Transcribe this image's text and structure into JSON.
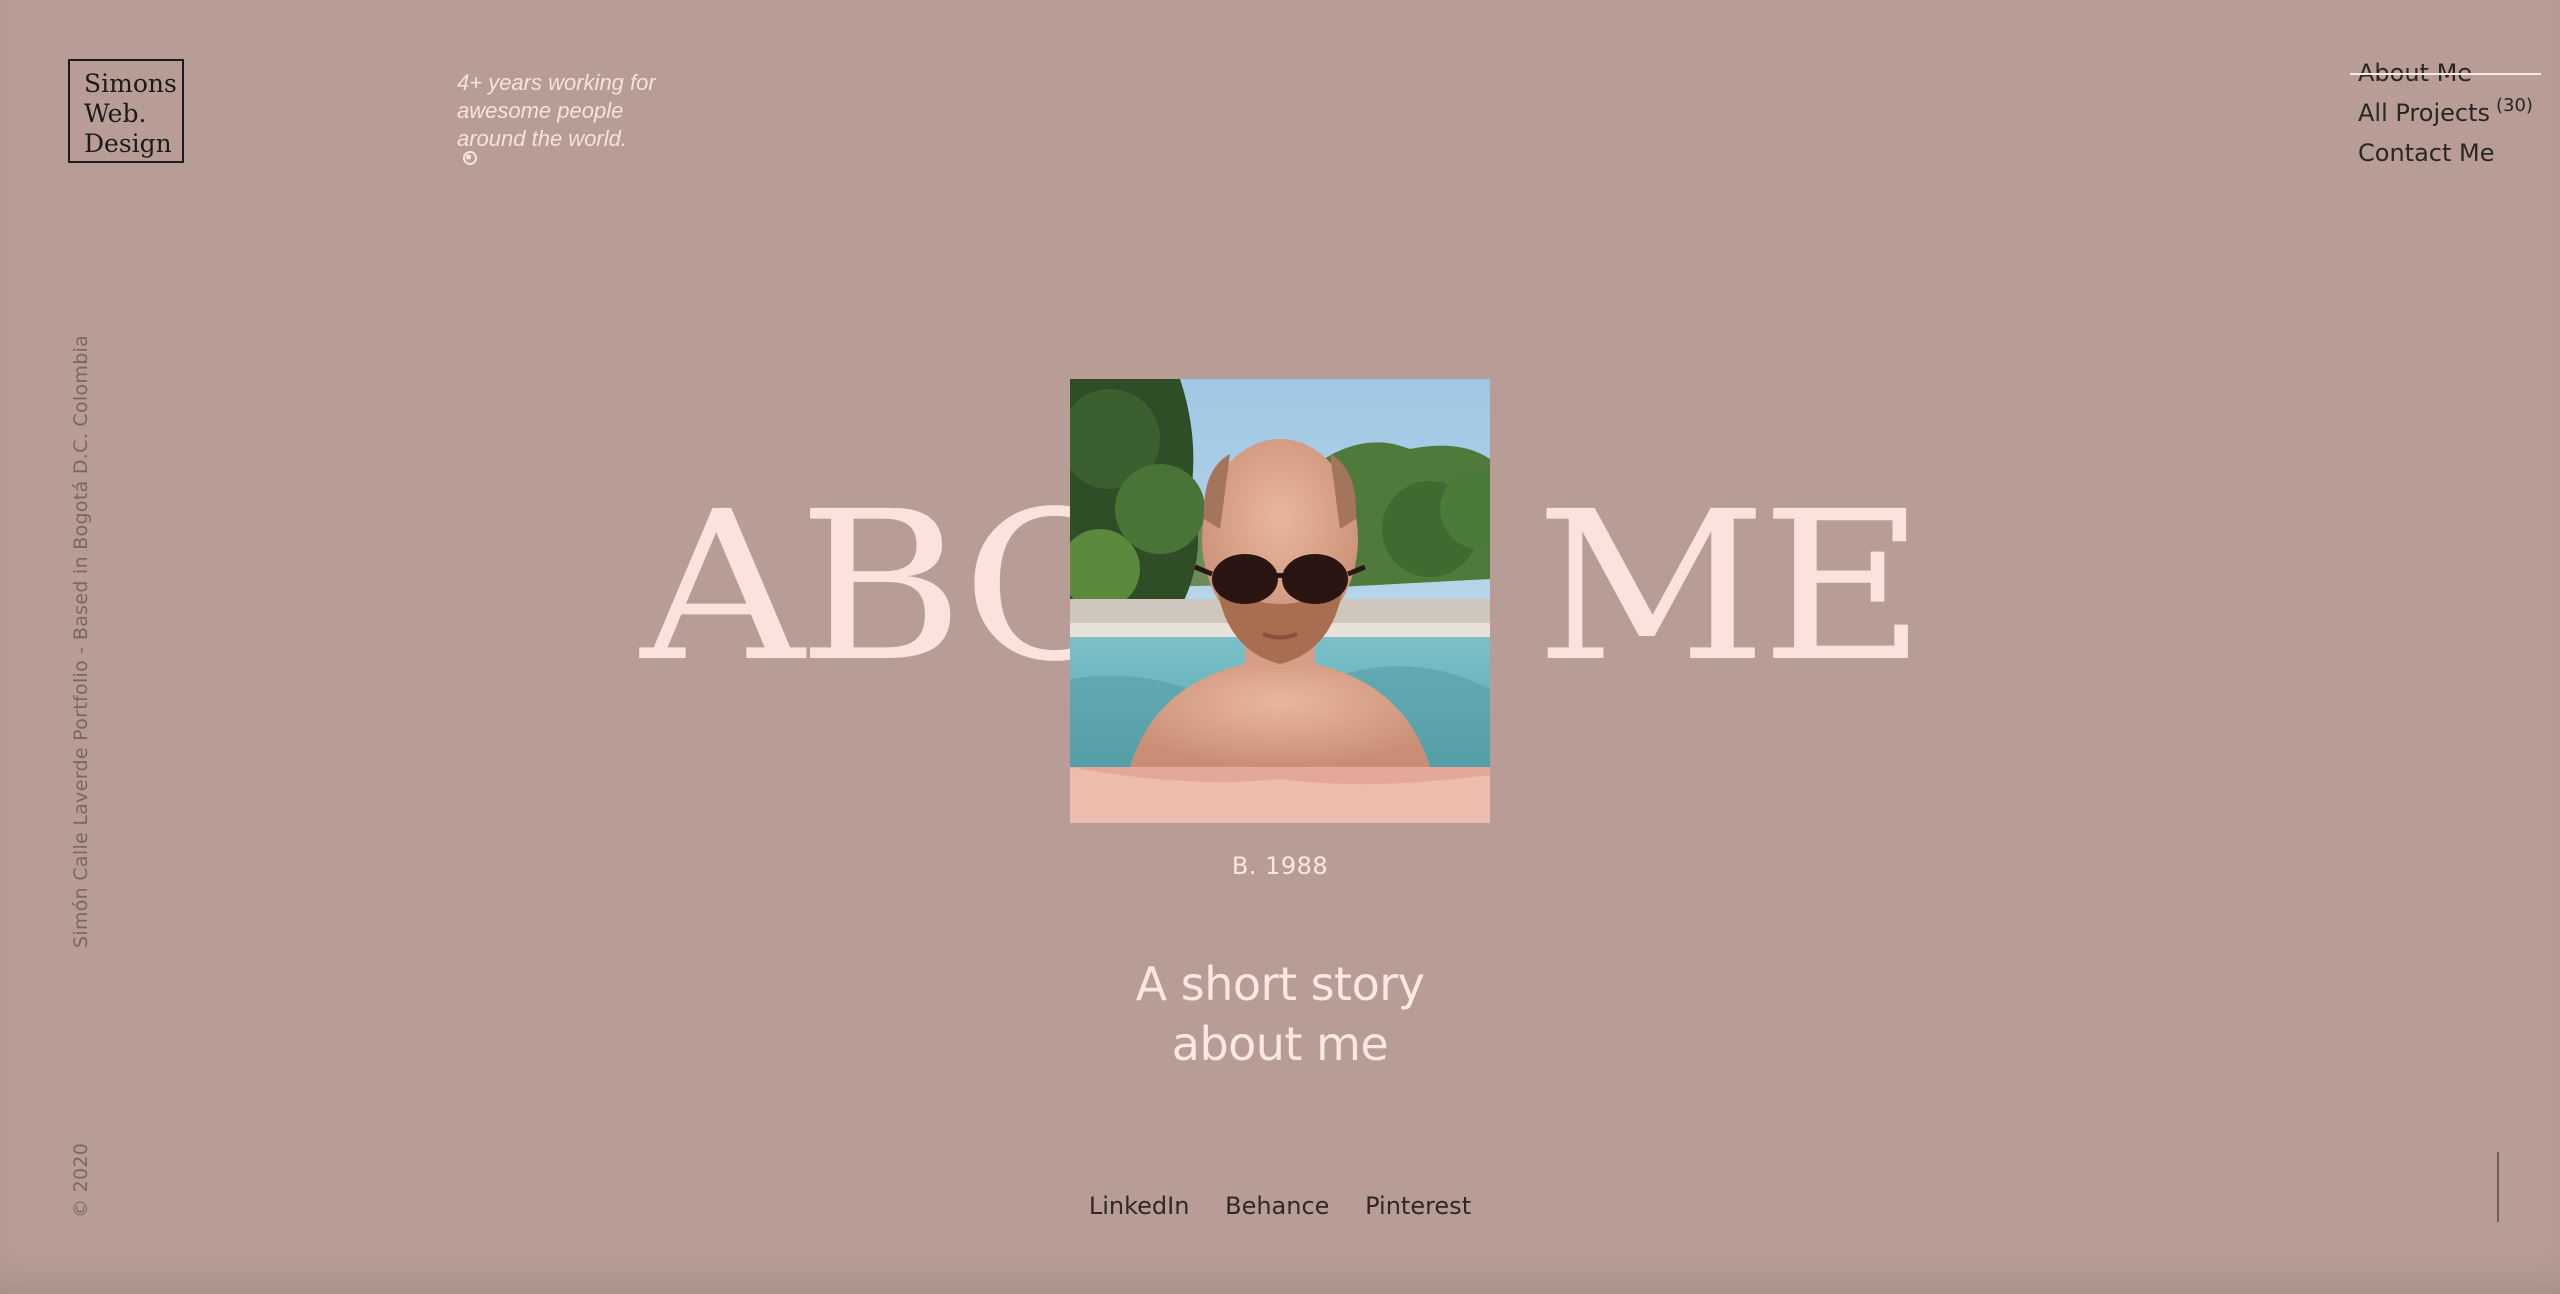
{
  "logo": {
    "line1": "Simons",
    "line2": "Web.",
    "line3": "Design"
  },
  "tagline": {
    "line1": "4+ years working for",
    "line2": "awesome people",
    "line3": "around the world."
  },
  "nav": {
    "about": "About Me",
    "projects": "All Projects",
    "projects_count": "(30)",
    "contact": "Contact Me"
  },
  "side": {
    "location": "Simón Calle Laverde Portfolio - Based in Bogotá D.C. Colombia",
    "copyright": "© 2020"
  },
  "hero": {
    "title": "ABOUT ME",
    "born": "B. 1988",
    "story_line1": "A short story",
    "story_line2": "about me"
  },
  "social": {
    "linkedin": "LinkedIn",
    "behance": "Behance",
    "pinterest": "Pinterest"
  },
  "colors": {
    "background": "#b79d95",
    "accent_light": "#fbe3dd",
    "text_dark": "#2a2624"
  }
}
